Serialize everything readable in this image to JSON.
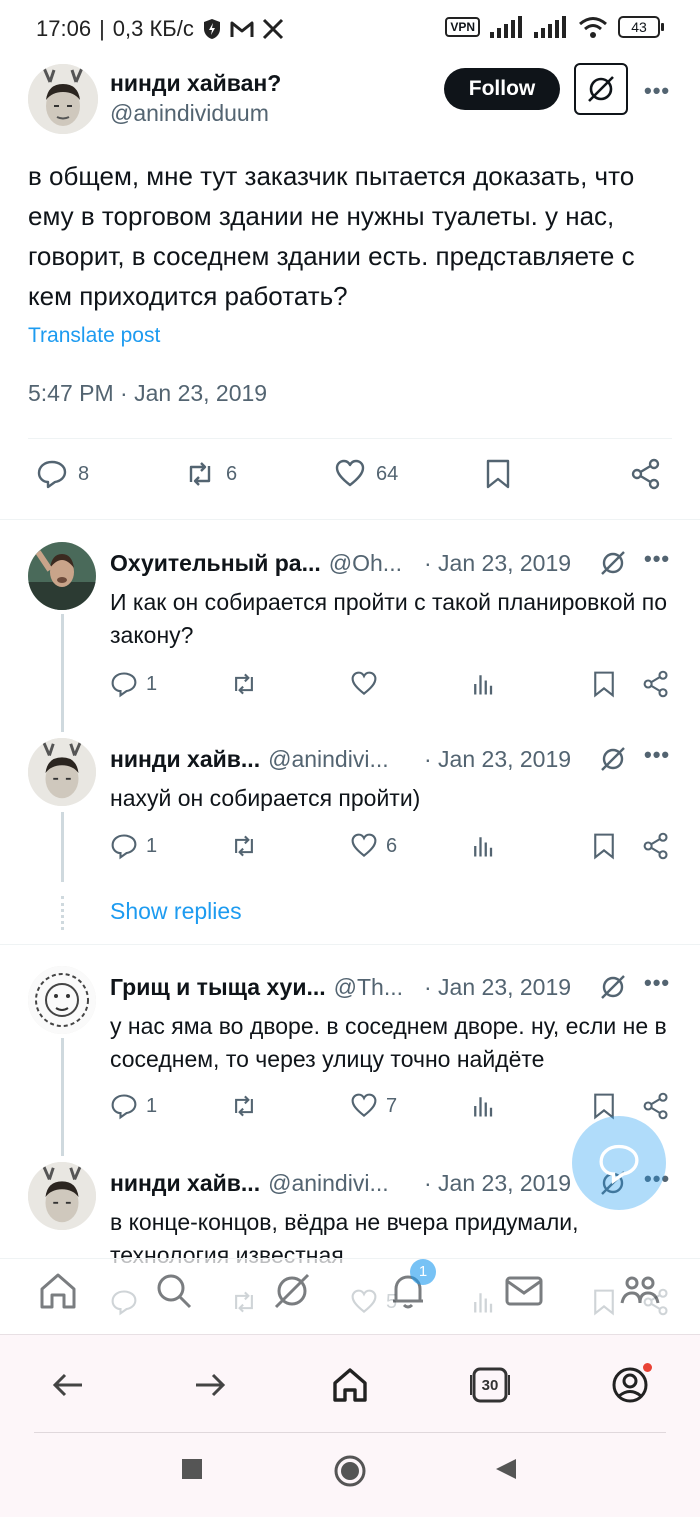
{
  "status_bar": {
    "time": "17:06",
    "speed": "0,3 КБ/с",
    "vpn_label": "VPN",
    "battery": "43"
  },
  "post": {
    "author_name": "нинди хайван?",
    "author_handle": "@anindividuum",
    "follow_label": "Follow",
    "more_label": "•••",
    "text": "в общем, мне тут заказчик пытается доказать, что ему в торговом здании не нужны туалеты. у нас, говорит, в соседнем здании есть. представляете с кем приходится работать?",
    "translate_label": "Translate post",
    "timestamp": "5:47 PM · Jan 23, 2019",
    "replies": "8",
    "reposts": "6",
    "likes": "64"
  },
  "replies": [
    {
      "name": "Охуительный ра...",
      "handle": "@Oh...",
      "date": "· Jan 23, 2019",
      "text": "И как он собирается пройти с такой планировкой по закону?",
      "replies": "1",
      "reposts": "",
      "likes": ""
    },
    {
      "name": "нинди хайв...",
      "handle": "@anindivi...",
      "date": "· Jan 23, 2019",
      "text": "нахуй он собирается пройти)",
      "replies": "1",
      "reposts": "",
      "likes": "6"
    },
    {
      "name": "Грищ и тыща хуи...",
      "handle": "@Th...",
      "date": "· Jan 23, 2019",
      "text": "у нас яма во дворе. в соседнем дворе. ну, если не в соседнем, то через улицу точно найдёте",
      "replies": "1",
      "reposts": "",
      "likes": "7"
    },
    {
      "name": "нинди хайв...",
      "handle": "@anindivi...",
      "date": "· Jan 23, 2019",
      "text": "в конце-концов, вёдра не вчера придумали, технология известная",
      "replies": "",
      "reposts": "",
      "likes": "5"
    }
  ],
  "show_replies_label": "Show replies",
  "nav": {
    "notifications_badge": "1"
  },
  "browser": {
    "tab_count": "30"
  },
  "colors": {
    "accent": "#1d9bf0",
    "text": "#0f1419",
    "secondary": "#536471"
  }
}
